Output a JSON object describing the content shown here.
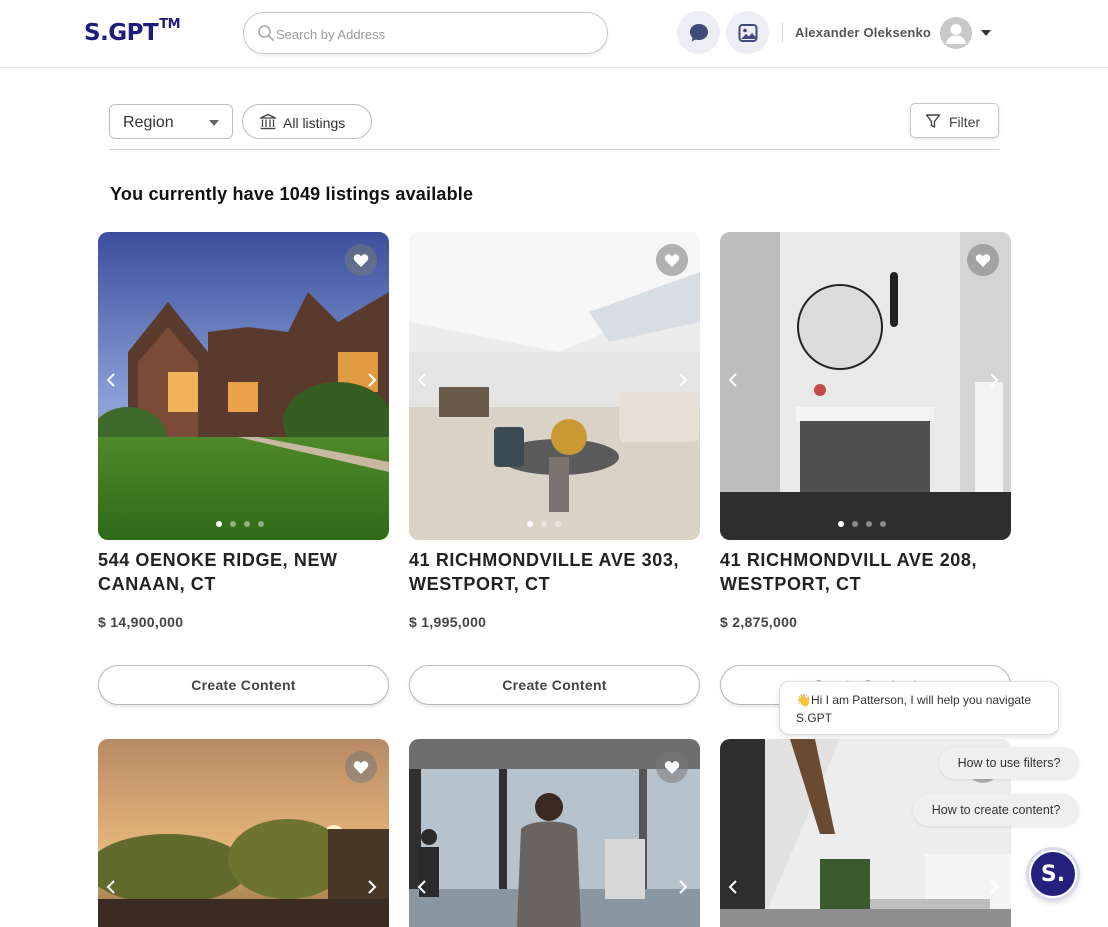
{
  "header": {
    "logo": "S.GPT",
    "logo_mark": "TM",
    "search_placeholder": "Search by Address",
    "user_name": "Alexander Oleksenko",
    "icons": [
      "search-icon",
      "chat-bubble-icon",
      "image-gallery-icon",
      "user-avatar-icon",
      "caret-down-icon"
    ]
  },
  "toolbar": {
    "region_label": "Region",
    "all_listings_label": "All listings",
    "filter_label": "Filter"
  },
  "listings_summary": "You currently have 1049 listings available",
  "listings": [
    {
      "address": "544 OENOKE RIDGE, NEW CANAAN, CT",
      "price": "$ 14,900,000",
      "button": "Create Content",
      "dots": 4,
      "active_dot": 0
    },
    {
      "address": "41 RICHMONDVILLE AVE 303, WESTPORT, CT",
      "price": "$ 1,995,000",
      "button": "Create Content",
      "dots": 3,
      "active_dot": 0
    },
    {
      "address": "41 RICHMONDVILL AVE 208, WESTPORT, CT",
      "price": "$ 2,875,000",
      "button": "Create Content",
      "dots": 4,
      "active_dot": 0
    },
    {
      "address": "",
      "price": "",
      "button": "",
      "dots": 0,
      "active_dot": 0
    },
    {
      "address": "",
      "price": "",
      "button": "",
      "dots": 0,
      "active_dot": 0
    },
    {
      "address": "",
      "price": "",
      "button": "",
      "dots": 0,
      "active_dot": 0
    }
  ],
  "assistant": {
    "greeting_emoji": "👋",
    "greeting": "Hi I am Patterson, I will help you navigate S.GPT",
    "suggestions": [
      "How to use filters?",
      "How to create content?"
    ],
    "fab_label": "S."
  },
  "colors": {
    "brand": "#1f1d7a",
    "fab": "#23207e"
  }
}
